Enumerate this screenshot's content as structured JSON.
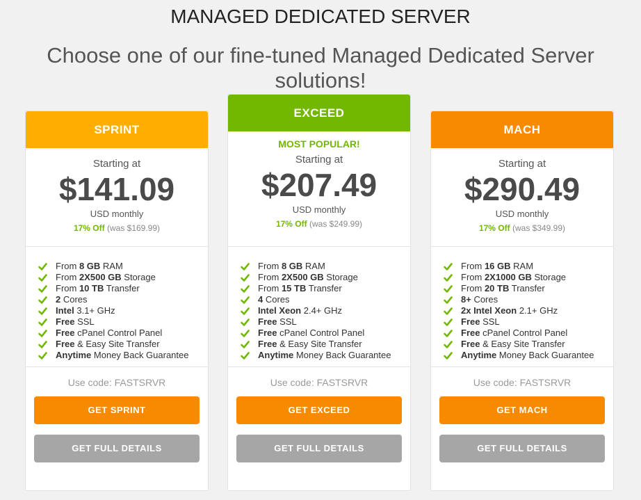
{
  "page": {
    "title": "MANAGED DEDICATED SERVER",
    "subtitle": "Choose one of our fine-tuned Managed Dedicated Server solutions!"
  },
  "colors": {
    "sprint_header": "#ffae00",
    "exceed_header": "#72b800",
    "mach_header": "#f88a00",
    "accent_green": "#72b800",
    "button_orange": "#f88a00",
    "button_gray": "#a6a6a6"
  },
  "plans": [
    {
      "name": "SPRINT",
      "popular": "",
      "starting_label": "Starting at",
      "price": "$141.09",
      "period": "USD monthly",
      "discount": "17% Off",
      "was": "(was $169.99)",
      "features": [
        {
          "pre": "From ",
          "bold": "8 GB",
          "post": " RAM"
        },
        {
          "pre": "From ",
          "bold": "2X500 GB",
          "post": " Storage"
        },
        {
          "pre": "From ",
          "bold": "10 TB",
          "post": " Transfer"
        },
        {
          "pre": "",
          "bold": "2",
          "post": " Cores"
        },
        {
          "pre": "",
          "bold": "Intel",
          "post": " 3.1+ GHz"
        },
        {
          "pre": "",
          "bold": "Free",
          "post": " SSL"
        },
        {
          "pre": "",
          "bold": "Free",
          "post": " cPanel Control Panel"
        },
        {
          "pre": "",
          "bold": "Free",
          "post": " & Easy Site Transfer"
        },
        {
          "pre": "",
          "bold": "Anytime",
          "post": " Money Back Guarantee"
        }
      ],
      "code": "Use code: FASTSRVR",
      "cta": "GET SPRINT",
      "details": "GET FULL DETAILS"
    },
    {
      "name": "EXCEED",
      "popular": "MOST POPULAR!",
      "starting_label": "Starting at",
      "price": "$207.49",
      "period": "USD monthly",
      "discount": "17% Off",
      "was": "(was $249.99)",
      "features": [
        {
          "pre": "From ",
          "bold": "8 GB",
          "post": " RAM"
        },
        {
          "pre": "From ",
          "bold": "2X500 GB",
          "post": " Storage"
        },
        {
          "pre": "From ",
          "bold": "15 TB",
          "post": " Transfer"
        },
        {
          "pre": "",
          "bold": "4",
          "post": " Cores"
        },
        {
          "pre": "",
          "bold": "Intel Xeon",
          "post": " 2.4+ GHz"
        },
        {
          "pre": "",
          "bold": "Free",
          "post": " SSL"
        },
        {
          "pre": "",
          "bold": "Free",
          "post": " cPanel Control Panel"
        },
        {
          "pre": "",
          "bold": "Free",
          "post": " & Easy Site Transfer"
        },
        {
          "pre": "",
          "bold": "Anytime",
          "post": " Money Back Guarantee"
        }
      ],
      "code": "Use code: FASTSRVR",
      "cta": "GET EXCEED",
      "details": "GET FULL DETAILS"
    },
    {
      "name": "MACH",
      "popular": "",
      "starting_label": "Starting at",
      "price": "$290.49",
      "period": "USD monthly",
      "discount": "17% Off",
      "was": "(was $349.99)",
      "features": [
        {
          "pre": "From ",
          "bold": "16 GB",
          "post": " RAM"
        },
        {
          "pre": "From ",
          "bold": "2X1000 GB",
          "post": " Storage"
        },
        {
          "pre": "From ",
          "bold": "20 TB",
          "post": " Transfer"
        },
        {
          "pre": "",
          "bold": "8+",
          "post": " Cores"
        },
        {
          "pre": "",
          "bold": "2x Intel Xeon",
          "post": " 2.1+ GHz"
        },
        {
          "pre": "",
          "bold": "Free",
          "post": " SSL"
        },
        {
          "pre": "",
          "bold": "Free",
          "post": " cPanel Control Panel"
        },
        {
          "pre": "",
          "bold": "Free",
          "post": " & Easy Site Transfer"
        },
        {
          "pre": "",
          "bold": "Anytime",
          "post": " Money Back Guarantee"
        }
      ],
      "code": "Use code: FASTSRVR",
      "cta": "GET MACH",
      "details": "GET FULL DETAILS"
    }
  ]
}
